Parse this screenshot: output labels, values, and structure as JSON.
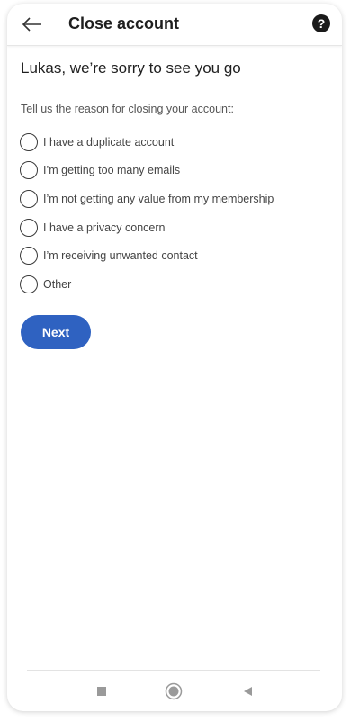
{
  "header": {
    "title": "Close account",
    "back_icon": "back-arrow-icon",
    "help_icon": "help-icon",
    "help_glyph": "?"
  },
  "main": {
    "heading": "Lukas, we’re sorry to see you go",
    "prompt": "Tell us the reason for closing your account:",
    "options": [
      {
        "label": "I have a duplicate account",
        "selected": false
      },
      {
        "label": "I’m getting too many emails",
        "selected": false
      },
      {
        "label": "I’m not getting any value from my membership",
        "selected": false
      },
      {
        "label": "I have a privacy concern",
        "selected": false
      },
      {
        "label": "I’m receiving unwanted contact",
        "selected": false
      },
      {
        "label": "Other",
        "selected": false
      }
    ],
    "next_label": "Next"
  },
  "navbar": {
    "icons": [
      "recents-square-icon",
      "home-circle-icon",
      "back-triangle-icon"
    ]
  },
  "colors": {
    "accent": "#2f62c1",
    "text_primary": "#1f1f1f",
    "text_secondary": "#555555"
  }
}
